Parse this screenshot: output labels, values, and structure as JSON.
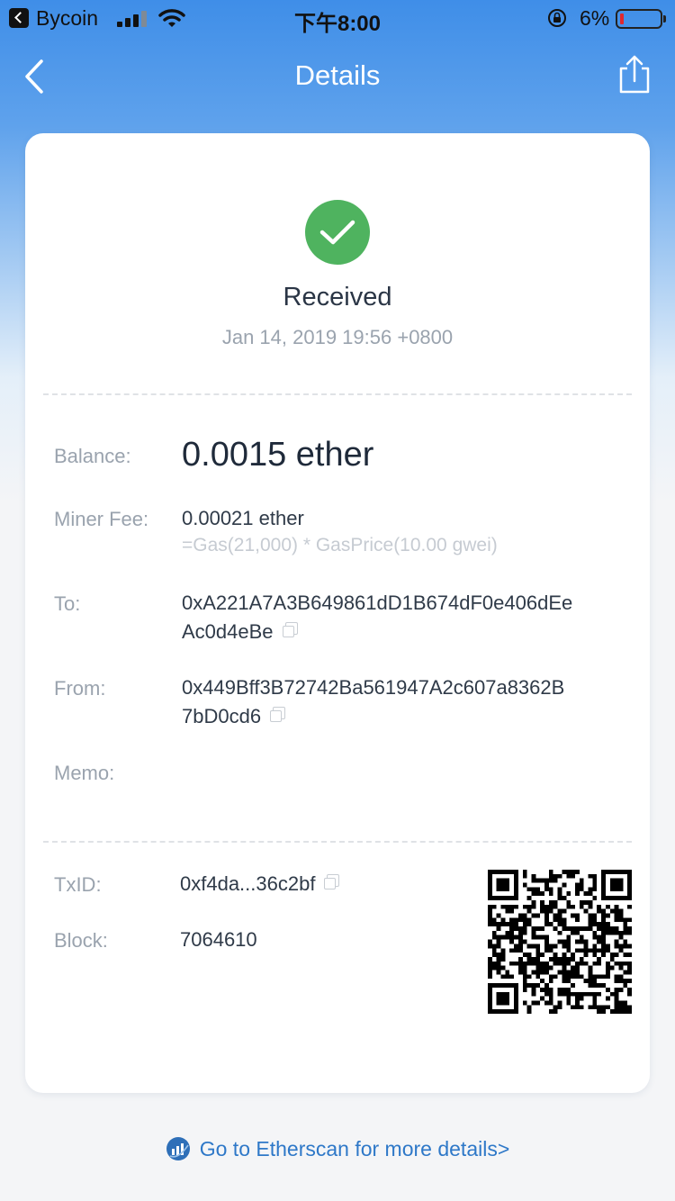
{
  "status_bar": {
    "app_name": "Bycoin",
    "time": "下午8:00",
    "battery_percent": "6%",
    "battery_level": 0.06,
    "signal_bars": 3
  },
  "nav": {
    "title": "Details",
    "back_icon": "chevron-left-icon",
    "share_icon": "share-icon"
  },
  "transaction": {
    "status_icon": "check-icon",
    "status": "Received",
    "date": "Jan 14, 2019 19:56 +0800",
    "balance_label": "Balance:",
    "balance_value": "0.0015 ether",
    "miner_fee_label": "Miner Fee:",
    "miner_fee_value": "0.00021 ether",
    "miner_fee_formula": "=Gas(21,000) * GasPrice(10.00 gwei)",
    "to_label": "To:",
    "to_line1": "0xA221A7A3B649861dD1B674dF0e406dEe",
    "to_line2": "Ac0d4eBe",
    "from_label": "From:",
    "from_line1": "0x449Bff3B72742Ba561947A2c607a8362B",
    "from_line2": "7bD0cd6",
    "memo_label": "Memo:",
    "memo_value": "",
    "txid_label": "TxID:",
    "txid_value": "0xf4da...36c2bf",
    "block_label": "Block:",
    "block_value": "7064610"
  },
  "footer": {
    "link_text": "Go to Etherscan for more details>",
    "icon": "etherscan-icon"
  },
  "colors": {
    "header_blue": "#3f8ee8",
    "success_green": "#4fb35f",
    "link_blue": "#2e78c8",
    "label_gray": "#9aa3ae"
  }
}
